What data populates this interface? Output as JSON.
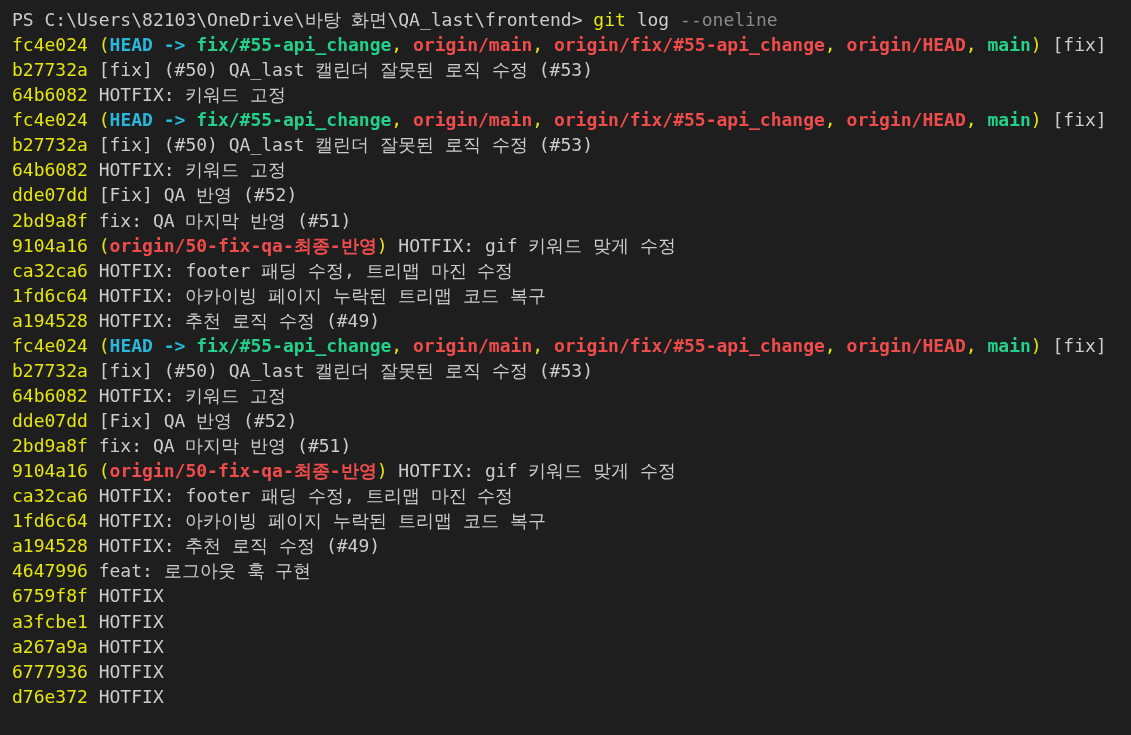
{
  "terminal": {
    "lines": [
      {
        "segments": [
          {
            "kind": "prompt",
            "text": "PS C:\\Users\\82103\\OneDrive\\바탕 화면\\QA_last\\frontend> "
          },
          {
            "kind": "command",
            "text": "git"
          },
          {
            "kind": "text",
            "text": " log "
          },
          {
            "kind": "flag",
            "text": "--oneline"
          }
        ]
      },
      {
        "segments": [
          {
            "kind": "hash",
            "text": "fc4e024"
          },
          {
            "kind": "punct",
            "text": " ("
          },
          {
            "kind": "head",
            "text": "HEAD -> "
          },
          {
            "kind": "local",
            "text": "fix/#55-api_change"
          },
          {
            "kind": "punct",
            "text": ", "
          },
          {
            "kind": "remote",
            "text": "origin/main"
          },
          {
            "kind": "punct",
            "text": ", "
          },
          {
            "kind": "remote",
            "text": "origin/fix/#55-api_change"
          },
          {
            "kind": "punct",
            "text": ", "
          },
          {
            "kind": "remote",
            "text": "origin/HEAD"
          },
          {
            "kind": "punct",
            "text": ", "
          },
          {
            "kind": "local",
            "text": "main"
          },
          {
            "kind": "punct",
            "text": ")"
          },
          {
            "kind": "text",
            "text": " [fix]"
          }
        ]
      },
      {
        "segments": [
          {
            "kind": "hash",
            "text": "b27732a"
          },
          {
            "kind": "text",
            "text": " [fix] (#50) QA_last 캘린더 잘못된 로직 수정 (#53)"
          }
        ]
      },
      {
        "segments": [
          {
            "kind": "hash",
            "text": "64b6082"
          },
          {
            "kind": "text",
            "text": " HOTFIX: 키워드 고정"
          }
        ]
      },
      {
        "segments": [
          {
            "kind": "hash",
            "text": "fc4e024"
          },
          {
            "kind": "punct",
            "text": " ("
          },
          {
            "kind": "head",
            "text": "HEAD -> "
          },
          {
            "kind": "local",
            "text": "fix/#55-api_change"
          },
          {
            "kind": "punct",
            "text": ", "
          },
          {
            "kind": "remote",
            "text": "origin/main"
          },
          {
            "kind": "punct",
            "text": ", "
          },
          {
            "kind": "remote",
            "text": "origin/fix/#55-api_change"
          },
          {
            "kind": "punct",
            "text": ", "
          },
          {
            "kind": "remote",
            "text": "origin/HEAD"
          },
          {
            "kind": "punct",
            "text": ", "
          },
          {
            "kind": "local",
            "text": "main"
          },
          {
            "kind": "punct",
            "text": ")"
          },
          {
            "kind": "text",
            "text": " [fix]"
          }
        ]
      },
      {
        "segments": [
          {
            "kind": "hash",
            "text": "b27732a"
          },
          {
            "kind": "text",
            "text": " [fix] (#50) QA_last 캘린더 잘못된 로직 수정 (#53)"
          }
        ]
      },
      {
        "segments": [
          {
            "kind": "hash",
            "text": "64b6082"
          },
          {
            "kind": "text",
            "text": " HOTFIX: 키워드 고정"
          }
        ]
      },
      {
        "segments": [
          {
            "kind": "hash",
            "text": "dde07dd"
          },
          {
            "kind": "text",
            "text": " [Fix] QA 반영 (#52)"
          }
        ]
      },
      {
        "segments": [
          {
            "kind": "hash",
            "text": "2bd9a8f"
          },
          {
            "kind": "text",
            "text": " fix: QA 마지막 반영 (#51)"
          }
        ]
      },
      {
        "segments": [
          {
            "kind": "hash",
            "text": "9104a16"
          },
          {
            "kind": "punct",
            "text": " ("
          },
          {
            "kind": "remote",
            "text": "origin/50-fix-qa-최종-반영"
          },
          {
            "kind": "punct",
            "text": ")"
          },
          {
            "kind": "text",
            "text": " HOTFIX: gif 키워드 맞게 수정"
          }
        ]
      },
      {
        "segments": [
          {
            "kind": "hash",
            "text": "ca32ca6"
          },
          {
            "kind": "text",
            "text": " HOTFIX: footer 패딩 수정, 트리맵 마진 수정"
          }
        ]
      },
      {
        "segments": [
          {
            "kind": "hash",
            "text": "1fd6c64"
          },
          {
            "kind": "text",
            "text": " HOTFIX: 아카이빙 페이지 누락된 트리맵 코드 복구"
          }
        ]
      },
      {
        "segments": [
          {
            "kind": "hash",
            "text": "a194528"
          },
          {
            "kind": "text",
            "text": " HOTFIX: 추천 로직 수정 (#49)"
          }
        ]
      },
      {
        "segments": [
          {
            "kind": "hash",
            "text": "fc4e024"
          },
          {
            "kind": "punct",
            "text": " ("
          },
          {
            "kind": "head",
            "text": "HEAD -> "
          },
          {
            "kind": "local",
            "text": "fix/#55-api_change"
          },
          {
            "kind": "punct",
            "text": ", "
          },
          {
            "kind": "remote",
            "text": "origin/main"
          },
          {
            "kind": "punct",
            "text": ", "
          },
          {
            "kind": "remote",
            "text": "origin/fix/#55-api_change"
          },
          {
            "kind": "punct",
            "text": ", "
          },
          {
            "kind": "remote",
            "text": "origin/HEAD"
          },
          {
            "kind": "punct",
            "text": ", "
          },
          {
            "kind": "local",
            "text": "main"
          },
          {
            "kind": "punct",
            "text": ")"
          },
          {
            "kind": "text",
            "text": " [fix]"
          }
        ]
      },
      {
        "segments": [
          {
            "kind": "hash",
            "text": "b27732a"
          },
          {
            "kind": "text",
            "text": " [fix] (#50) QA_last 캘린더 잘못된 로직 수정 (#53)"
          }
        ]
      },
      {
        "segments": [
          {
            "kind": "hash",
            "text": "64b6082"
          },
          {
            "kind": "text",
            "text": " HOTFIX: 키워드 고정"
          }
        ]
      },
      {
        "segments": [
          {
            "kind": "hash",
            "text": "dde07dd"
          },
          {
            "kind": "text",
            "text": " [Fix] QA 반영 (#52)"
          }
        ]
      },
      {
        "segments": [
          {
            "kind": "hash",
            "text": "2bd9a8f"
          },
          {
            "kind": "text",
            "text": " fix: QA 마지막 반영 (#51)"
          }
        ]
      },
      {
        "segments": [
          {
            "kind": "hash",
            "text": "9104a16"
          },
          {
            "kind": "punct",
            "text": " ("
          },
          {
            "kind": "remote",
            "text": "origin/50-fix-qa-최종-반영"
          },
          {
            "kind": "punct",
            "text": ")"
          },
          {
            "kind": "text",
            "text": " HOTFIX: gif 키워드 맞게 수정"
          }
        ]
      },
      {
        "segments": [
          {
            "kind": "hash",
            "text": "ca32ca6"
          },
          {
            "kind": "text",
            "text": " HOTFIX: footer 패딩 수정, 트리맵 마진 수정"
          }
        ]
      },
      {
        "segments": [
          {
            "kind": "hash",
            "text": "1fd6c64"
          },
          {
            "kind": "text",
            "text": " HOTFIX: 아카이빙 페이지 누락된 트리맵 코드 복구"
          }
        ]
      },
      {
        "segments": [
          {
            "kind": "hash",
            "text": "a194528"
          },
          {
            "kind": "text",
            "text": " HOTFIX: 추천 로직 수정 (#49)"
          }
        ]
      },
      {
        "segments": [
          {
            "kind": "hash",
            "text": "4647996"
          },
          {
            "kind": "text",
            "text": " feat: 로그아웃 훅 구현"
          }
        ]
      },
      {
        "segments": [
          {
            "kind": "hash",
            "text": "6759f8f"
          },
          {
            "kind": "text",
            "text": " HOTFIX"
          }
        ]
      },
      {
        "segments": [
          {
            "kind": "hash",
            "text": "a3fcbe1"
          },
          {
            "kind": "text",
            "text": " HOTFIX"
          }
        ]
      },
      {
        "segments": [
          {
            "kind": "hash",
            "text": "a267a9a"
          },
          {
            "kind": "text",
            "text": " HOTFIX"
          }
        ]
      },
      {
        "segments": [
          {
            "kind": "hash",
            "text": "6777936"
          },
          {
            "kind": "text",
            "text": " HOTFIX"
          }
        ]
      },
      {
        "segments": [
          {
            "kind": "hash",
            "text": "d76e372"
          },
          {
            "kind": "text",
            "text": " HOTFIX"
          }
        ]
      }
    ]
  }
}
